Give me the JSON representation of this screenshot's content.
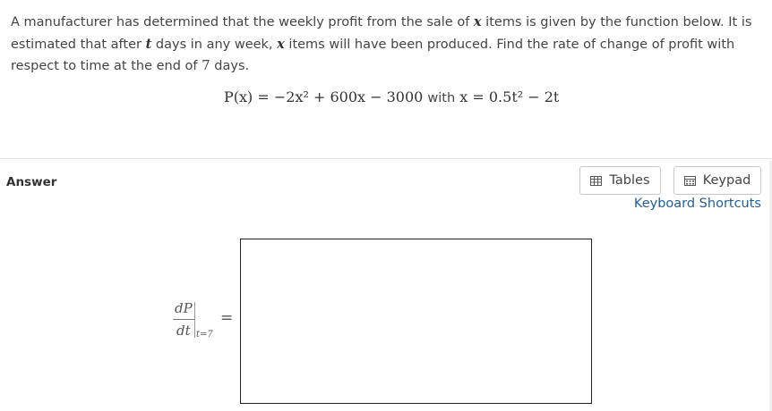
{
  "problem": {
    "p1": "A manufacturer has determined that the weekly profit from the sale of ",
    "x1": "x",
    "p2": " items is given by the function below. It is estimated that after ",
    "t1": "t",
    "p3": " days in any week, ",
    "x2": "x",
    "p4": " items will have been produced. Find the rate of change of profit with respect to time at the end of ",
    "days_num": "7",
    "p5": " days."
  },
  "equation": {
    "lhs": "P(x) = −2x² + 600x − 3000",
    "with": "with",
    "rhs": "x = 0.5t² − 2t"
  },
  "answer": {
    "label": "Answer",
    "derivative_numerator": "dP",
    "derivative_denominator": "dt",
    "derivative_eval": "t=7",
    "equals": "=",
    "input_value": ""
  },
  "toolbar": {
    "tables_label": "Tables",
    "keypad_label": "Keypad",
    "shortcuts_label": "Keyboard Shortcuts"
  },
  "icons": {
    "tables": "table-grid-icon",
    "keypad": "calculator-icon"
  },
  "colors": {
    "link": "#1f5f99",
    "border": "#c8c8c8"
  }
}
